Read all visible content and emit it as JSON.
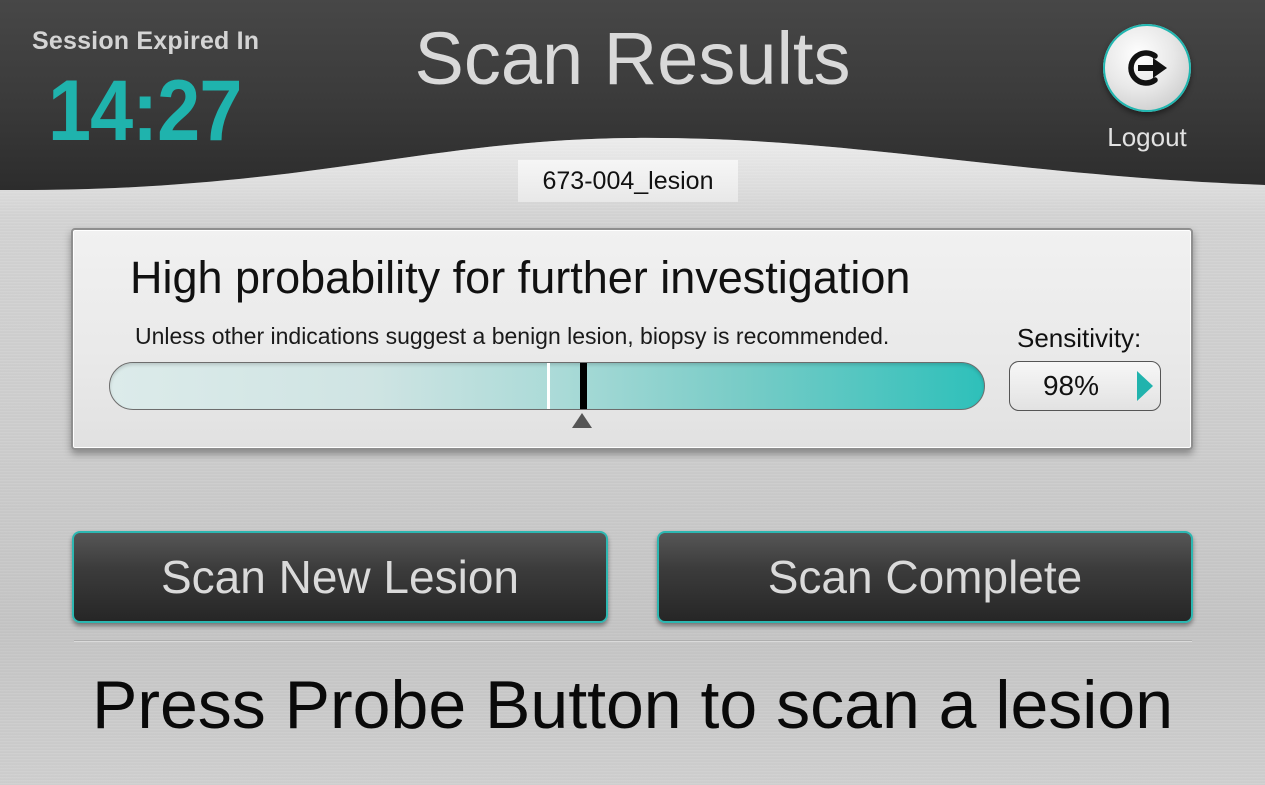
{
  "header": {
    "session_label": "Session Expired In",
    "timer": "14:27",
    "title": "Scan Results",
    "logout_icon": "logout-icon",
    "logout_label": "Logout",
    "lesion_id": "673-004_lesion"
  },
  "result": {
    "heading": "High probability for further investigation",
    "subtext": "Unless other indications suggest a benign lesion, biopsy is recommended.",
    "probability_marker_fraction": 0.54,
    "threshold_fraction": 0.5,
    "sensitivity_label": "Sensitivity:",
    "sensitivity_value": "98%"
  },
  "actions": {
    "scan_new_label": "Scan New Lesion",
    "scan_complete_label": "Scan Complete"
  },
  "instruction": "Press Probe Button to scan a lesion",
  "colors": {
    "accent": "#1fb3ad",
    "header_dark": "#343434",
    "button_dark": "#333333"
  }
}
